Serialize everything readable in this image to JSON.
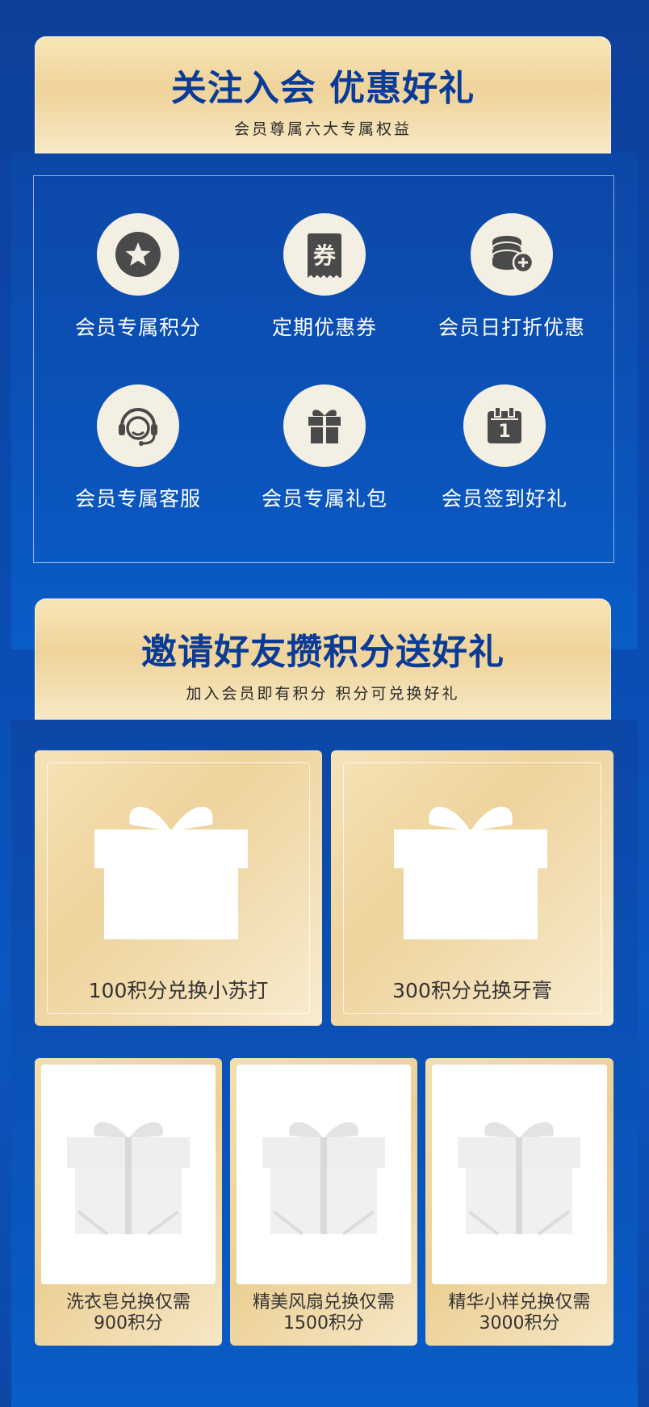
{
  "section1": {
    "title": "关注入会 优惠好礼",
    "subtitle": "会员尊属六大专属权益",
    "benefits": [
      {
        "label": "会员专属积分",
        "icon": "star-badge-icon"
      },
      {
        "label": "定期优惠券",
        "icon": "coupon-icon"
      },
      {
        "label": "会员日打折优惠",
        "icon": "coin-stack-add-icon"
      },
      {
        "label": "会员专属客服",
        "icon": "headset-icon"
      },
      {
        "label": "会员专属礼包",
        "icon": "gift-icon"
      },
      {
        "label": "会员签到好礼",
        "icon": "calendar-icon"
      }
    ],
    "coupon_glyph": "券",
    "calendar_number": "1"
  },
  "section2": {
    "title": "邀请好友攒积分送好礼",
    "subtitle": "加入会员即有积分 积分可兑换好礼",
    "big_gifts": [
      {
        "caption": "100积分兑换小苏打"
      },
      {
        "caption": "300积分兑换牙膏"
      }
    ],
    "small_gifts": [
      {
        "line1": "洗衣皂兑换仅需",
        "line2": "900积分"
      },
      {
        "line1": "精美风扇兑换仅需",
        "line2": "1500积分"
      },
      {
        "line1": "精华小样兑换仅需",
        "line2": "3000积分"
      }
    ]
  },
  "colors": {
    "brand_blue": "#0a3b96",
    "gold": "#efd39a",
    "icon_dark": "#4a4a4a"
  }
}
